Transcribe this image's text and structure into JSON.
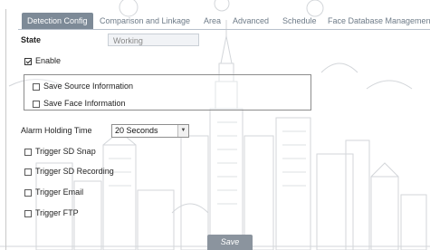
{
  "tabs": [
    {
      "label": "Detection Config",
      "active": true
    },
    {
      "label": "Comparison and Linkage",
      "active": false
    },
    {
      "label": "Area",
      "active": false
    },
    {
      "label": "Advanced",
      "active": false
    },
    {
      "label": "Schedule",
      "active": false
    },
    {
      "label": "Face Database Management",
      "active": false
    }
  ],
  "state": {
    "label": "State",
    "value": "Working"
  },
  "enable": {
    "label": "Enable",
    "checked": true
  },
  "group": {
    "save_source": {
      "label": "Save Source Information",
      "checked": false
    },
    "save_face": {
      "label": "Save Face Information",
      "checked": false
    }
  },
  "alarm_holding": {
    "label": "Alarm Holding Time",
    "value": "20 Seconds",
    "arrow": "▼"
  },
  "triggers": [
    {
      "label": "Trigger SD Snap",
      "checked": false
    },
    {
      "label": "Trigger SD Recording",
      "checked": false
    },
    {
      "label": "Trigger Email",
      "checked": false
    },
    {
      "label": "Trigger FTP",
      "checked": false
    }
  ],
  "save_button": {
    "label": "Save"
  },
  "colors": {
    "accent": "#7d8a97",
    "background_art": "#d3d6da"
  },
  "icons": {
    "checkbox": "checkbox-icon",
    "dropdown": "chevron-down-icon"
  }
}
